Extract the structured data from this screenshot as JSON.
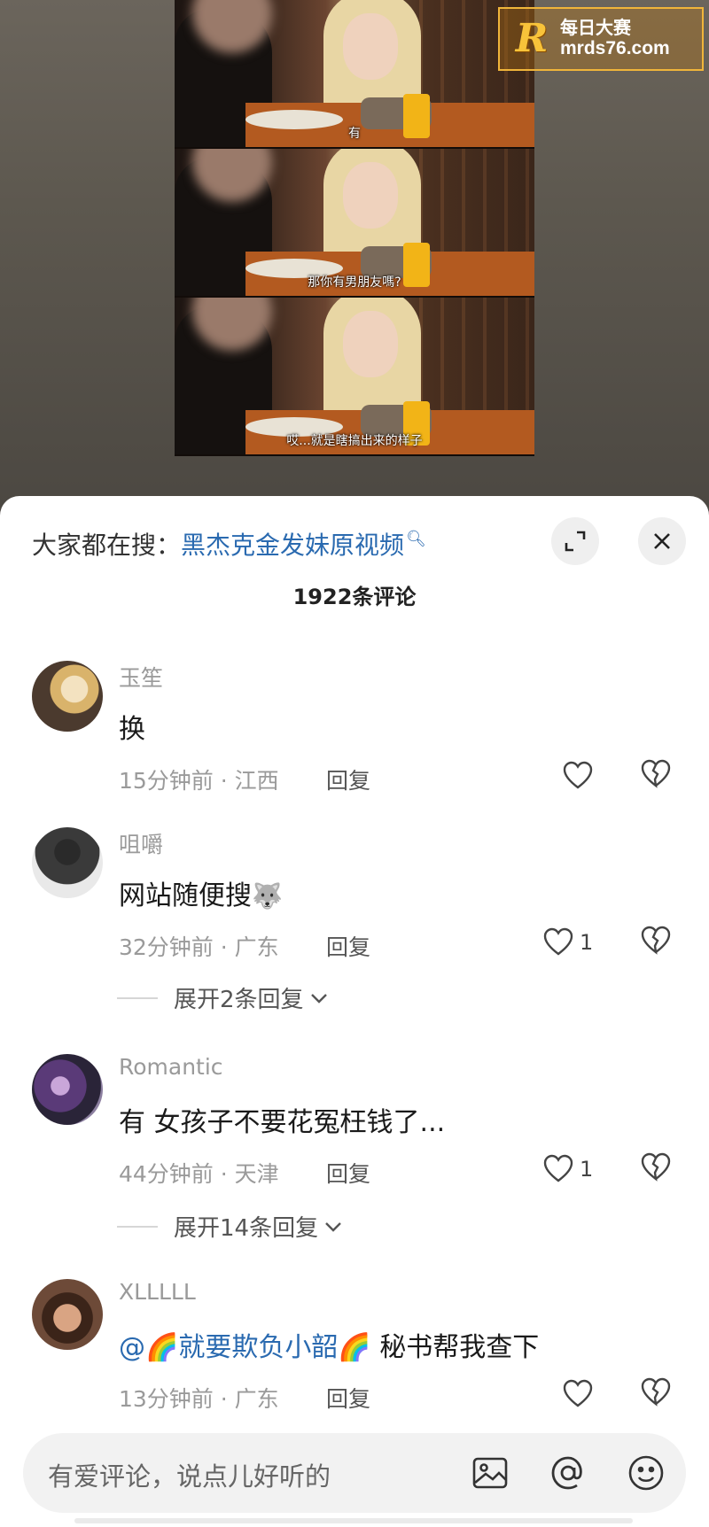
{
  "watermark": {
    "logo": "R",
    "brand_cn": "每日大赛",
    "url": "mrds76.com"
  },
  "video": {
    "subtitles": [
      "有",
      "那你有男朋友嗎?",
      "哎...就是瞎搞出来的样子"
    ]
  },
  "sheet": {
    "search_prefix": "大家都在搜：",
    "search_term": "黑杰克金发妹原视频",
    "comment_count": "1922条评论"
  },
  "comments": [
    {
      "user": "玉笙",
      "text": "换",
      "meta": "15分钟前 · 江西",
      "reply": "回复",
      "likes": ""
    },
    {
      "user": "咀嚼",
      "text": "网站随便搜",
      "meta": "32分钟前 · 广东",
      "reply": "回复",
      "likes": "1",
      "expand": "展开2条回复"
    },
    {
      "user": "Romantic",
      "text": "有 女孩子不要花冤枉钱了...",
      "meta": "44分钟前 · 天津",
      "reply": "回复",
      "likes": "1",
      "expand": "展开14条回复"
    },
    {
      "user": "XLLLLL",
      "mention": "@🌈就要欺负小韶🌈",
      "text": " 秘书帮我查下",
      "meta": "13分钟前 · 广东",
      "reply": "回复",
      "likes": ""
    }
  ],
  "input": {
    "placeholder": "有爱评论，说点儿好听的"
  },
  "icons": {
    "expand": "expand-icon",
    "close": "close-icon",
    "like": "heart-icon",
    "dislike": "broken-heart-icon",
    "image": "image-icon",
    "mention": "at-icon",
    "emoji": "emoji-icon"
  },
  "colors": {
    "link": "#2a6ab0",
    "meta": "#9a9a9a",
    "watermark": "#f0b53a"
  }
}
